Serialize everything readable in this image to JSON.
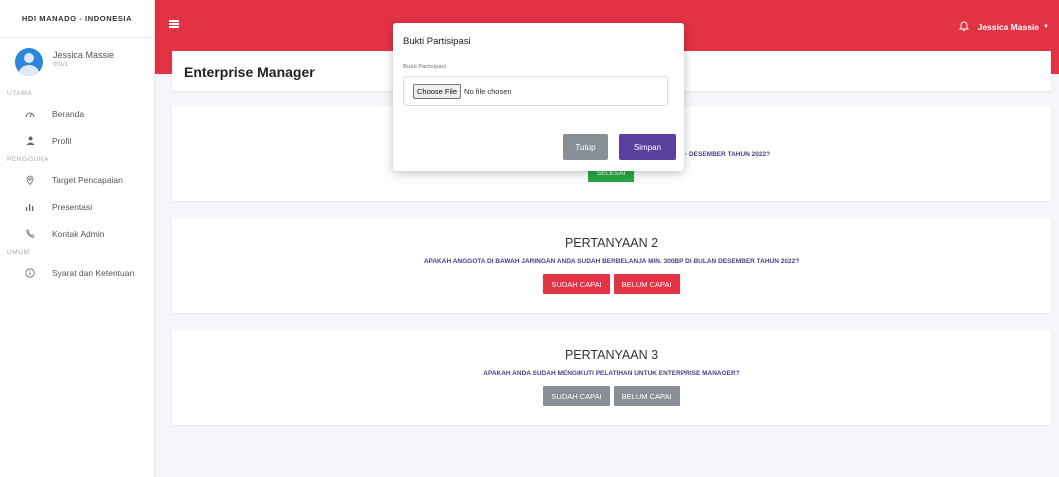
{
  "sidebar": {
    "brand": "HDI MANADO - INDONESIA",
    "user": {
      "name": "Jessica Massie",
      "code": "001/1"
    },
    "sections": {
      "utama": "UTAMA",
      "pengguna": "PENGGUNA",
      "umum": "UMUM"
    },
    "items": [
      {
        "label": "Beranda",
        "icon": "dashboard-icon"
      },
      {
        "label": "Profil",
        "icon": "user-icon"
      },
      {
        "label": "Target Pencapaian",
        "icon": "map-pin-icon"
      },
      {
        "label": "Presentasi",
        "icon": "bar-chart-icon"
      },
      {
        "label": "Kontak Admin",
        "icon": "phone-icon"
      },
      {
        "label": "Syarat dan Ketentuan",
        "icon": "info-icon"
      }
    ]
  },
  "topbar": {
    "user_name": "Jessica Massie"
  },
  "page": {
    "title": "Enterprise Manager"
  },
  "questions": [
    {
      "title": "",
      "text": "- DESEMBER TAHUN 2022?",
      "status_label": "SELESAI"
    },
    {
      "title": "PERTANYAAN 2",
      "text": "APAKAH ANGGOTA DI BAWAH JARINGAN ANDA SUDAH BERBELANJA MIN. 300BP DI BULAN DESEMBER TAHUN 2022?",
      "btn_yes": "SUDAH CAPAI",
      "btn_no": "BELUM CAPAI"
    },
    {
      "title": "PERTANYAAN 3",
      "text": "APAKAH ANDA SUDAH MENGIKUTI PELATIHAN UNTUK ENTERPRISE MANAGER?",
      "btn_yes": "SUDAH CAPAI",
      "btn_no": "BELUM CAPAI"
    }
  ],
  "modal": {
    "title": "Bukti Partisipasi",
    "field_label": "Bukti Partisipasi",
    "file_button": "Choose File",
    "file_status": "No file chosen",
    "close_label": "Tutup",
    "save_label": "Simpan"
  },
  "colors": {
    "topbar": "#e23345",
    "accent_purple": "#5b3f9c",
    "question_text": "#4a3f84",
    "success": "#28a745",
    "muted_button": "#888e94"
  }
}
